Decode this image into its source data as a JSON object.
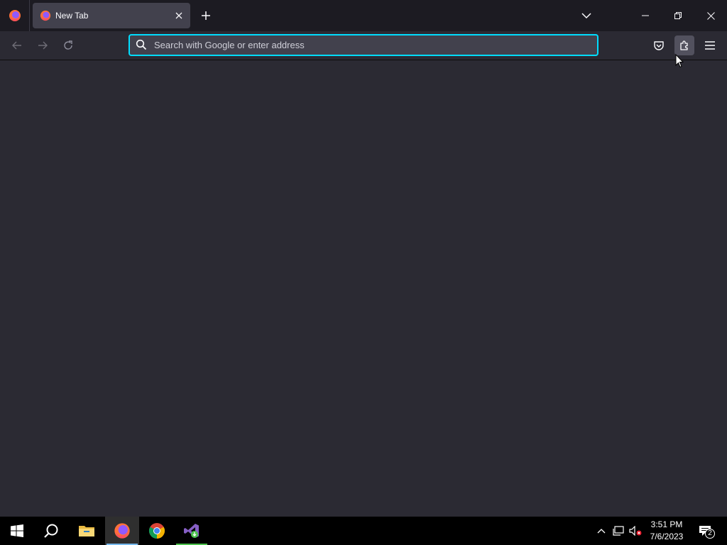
{
  "browser": {
    "tab": {
      "title": "New Tab",
      "favicon": "firefox-icon"
    },
    "urlbar": {
      "placeholder": "Search with Google or enter address",
      "value": ""
    },
    "accent": "#00ddff",
    "icons": {
      "menu": "firefox-icon",
      "tab_close": "close-icon",
      "new_tab": "plus-icon",
      "list_all_tabs": "chevron-down-icon",
      "minimize": "minimize-icon",
      "restore": "restore-icon",
      "close_window": "close-icon",
      "back": "arrow-left-icon",
      "forward": "arrow-right-icon",
      "reload": "reload-icon",
      "search": "search-icon",
      "pocket": "pocket-icon",
      "extensions": "puzzle-icon",
      "app_menu": "hamburger-icon"
    }
  },
  "taskbar": {
    "apps": [
      "start-icon",
      "search-icon",
      "file-explorer-icon",
      "firefox-icon",
      "chrome-icon",
      "visual-studio-installer-icon"
    ],
    "tray_icons": [
      "chevron-up-icon",
      "network-icon",
      "volume-muted-icon"
    ],
    "clock": {
      "time": "3:51 PM",
      "date": "7/6/2023"
    },
    "notification_count": "2"
  }
}
